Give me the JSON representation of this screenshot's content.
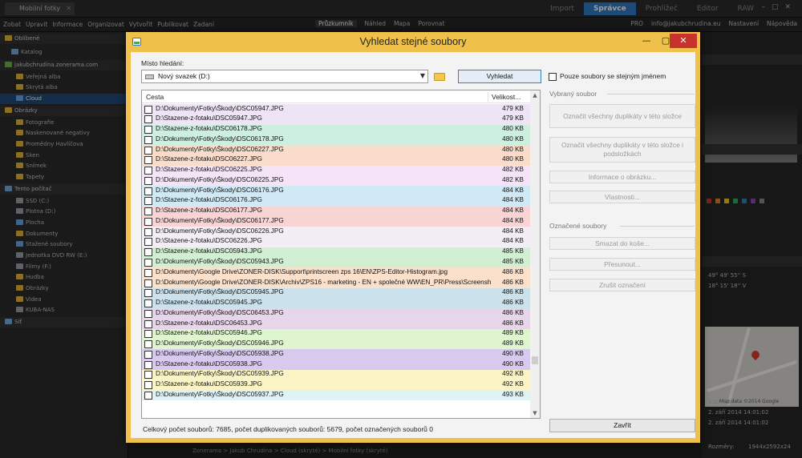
{
  "app": {
    "tab_title": "Mobilní fotky",
    "modes": [
      "Import",
      "Správce",
      "Prohlížeč",
      "Editor",
      "RAW"
    ],
    "active_mode": "Správce",
    "menu": [
      "Zobat",
      "Upravit",
      "Informace",
      "Organizovat",
      "Vytvořit",
      "Publikovat",
      "Zadaní"
    ],
    "views": [
      "Průzkumník",
      "Náhled",
      "Mapa",
      "Porovnat"
    ],
    "user_badge": "PRO",
    "user_email": "info@jakubchrudina.eu",
    "settings_label": "Nastavení",
    "help_label": "Nápověda",
    "sidebar": [
      {
        "label": "Oblíbené",
        "type": "hdr",
        "color": "#e3b23c"
      },
      {
        "label": "Katalog",
        "type": "item",
        "color": "#7aa7d8"
      },
      {
        "label": "jakubchrudina.zonerama.com",
        "type": "hdr",
        "color": "#6fb24a"
      },
      {
        "label": "Veřejná alba",
        "type": "item",
        "color": "#e3b23c"
      },
      {
        "label": "Skrytá alba",
        "type": "item",
        "color": "#e3b23c"
      },
      {
        "label": "Cloud",
        "type": "sel",
        "color": "#6aa5e0"
      },
      {
        "label": "Obrázky",
        "type": "hdr",
        "color": "#e3b23c"
      },
      {
        "label": "Fotografie",
        "type": "item",
        "color": "#e3b23c"
      },
      {
        "label": "Naskenované negativy",
        "type": "item",
        "color": "#e3b23c"
      },
      {
        "label": "Promědny Havlíčova",
        "type": "item",
        "color": "#e3b23c"
      },
      {
        "label": "Sken",
        "type": "item",
        "color": "#e3b23c"
      },
      {
        "label": "Snímek",
        "type": "item",
        "color": "#e3b23c"
      },
      {
        "label": "Tapety",
        "type": "item",
        "color": "#e3b23c"
      },
      {
        "label": "Tento počítač",
        "type": "hdr",
        "color": "#7aa7d8"
      },
      {
        "label": "SSD (C:)",
        "type": "item",
        "color": "#9aa0a6"
      },
      {
        "label": "Plotna (D:)",
        "type": "item",
        "color": "#9aa0a6"
      },
      {
        "label": "Plocha",
        "type": "item",
        "color": "#6aa5e0"
      },
      {
        "label": "Dokumenty",
        "type": "item",
        "color": "#e3b23c"
      },
      {
        "label": "Stažené soubory",
        "type": "item",
        "color": "#6aa5e0"
      },
      {
        "label": "Jednotka DVD RW (E:)",
        "type": "item",
        "color": "#9aa0a6"
      },
      {
        "label": "Filmy (F:)",
        "type": "item",
        "color": "#9aa0a6"
      },
      {
        "label": "Hudba",
        "type": "item",
        "color": "#e3b23c"
      },
      {
        "label": "Obrázky",
        "type": "item",
        "color": "#e3b23c"
      },
      {
        "label": "Videa",
        "type": "item",
        "color": "#e3b23c"
      },
      {
        "label": "KUBA-NAS",
        "type": "item",
        "color": "#9aa0a6"
      },
      {
        "label": "Síť",
        "type": "hdr",
        "color": "#7aa7d8"
      }
    ],
    "info_panel": {
      "gps_lat": "49° 49' 55'' S",
      "gps_lon": "18° 15' 18'' V",
      "map_credit": "Map data ©2014 Google",
      "file_size": "1,07 MB",
      "date_created": "2. září 2014 14:01:02",
      "date_modified": "2. září 2014 14:01:02",
      "dimensions_label": "Rozměry:",
      "dimensions": "1944x2592x24"
    },
    "breadcrumb": "Zonerama > Jakub Chrudina > Cloud (skryté) > Mobilní fotky (skryté)"
  },
  "dialog": {
    "title": "Vyhledat stejné soubory",
    "search_location_label": "Místo hledání:",
    "drive_value": "Nový svazek (D:)",
    "search_button": "Vyhledat",
    "same_name_label": "Pouze soubory se stejným jménem",
    "same_name_checked": false,
    "selected_file_group": "Vybraný soubor",
    "mark_dups_folder": "Označit všechny duplikáty v této složce",
    "mark_dups_subfolders": "Označit všechny duplikáty v této složce i podsložkách",
    "image_info": "Informace o obrázku...",
    "properties": "Vlastnosti...",
    "marked_files_group": "Označené soubory",
    "delete_to_trash": "Smazat do koše...",
    "move": "Přesunout...",
    "unmark": "Zrušit označení",
    "close": "Zavřít",
    "col_path": "Cesta",
    "col_size": "Velikost...",
    "status": "Celkový počet souborů: 7685, počet duplikovaných souborů: 5679, počet označených souborů 0",
    "rows": [
      {
        "path": "D:\\Dokumenty\\Fotky\\Škody\\DSC05947.JPG",
        "size": "479 KB",
        "color": "#efe3f6"
      },
      {
        "path": "D:\\Stazene-z-fotaku\\DSC05947.JPG",
        "size": "479 KB",
        "color": "#efe3f6"
      },
      {
        "path": "D:\\Stazene-z-fotaku\\DSC06178.JPG",
        "size": "480 KB",
        "color": "#ccefe0"
      },
      {
        "path": "D:\\Dokumenty\\Fotky\\Škody\\DSC06178.JPG",
        "size": "480 KB",
        "color": "#ccefe0"
      },
      {
        "path": "D:\\Dokumenty\\Fotky\\Škody\\DSC06227.JPG",
        "size": "480 KB",
        "color": "#f9dcc9"
      },
      {
        "path": "D:\\Stazene-z-fotaku\\DSC06227.JPG",
        "size": "480 KB",
        "color": "#f9dcc9"
      },
      {
        "path": "D:\\Stazene-z-fotaku\\DSC06225.JPG",
        "size": "482 KB",
        "color": "#f5e3f7"
      },
      {
        "path": "D:\\Dokumenty\\Fotky\\Škody\\DSC06225.JPG",
        "size": "482 KB",
        "color": "#f5e3f7"
      },
      {
        "path": "D:\\Dokumenty\\Fotky\\Škody\\DSC06176.JPG",
        "size": "484 KB",
        "color": "#cfe9f5"
      },
      {
        "path": "D:\\Stazene-z-fotaku\\DSC06176.JPG",
        "size": "484 KB",
        "color": "#cfe9f5"
      },
      {
        "path": "D:\\Stazene-z-fotaku\\DSC06177.JPG",
        "size": "484 KB",
        "color": "#f8d4d4"
      },
      {
        "path": "D:\\Dokumenty\\Fotky\\Škody\\DSC06177.JPG",
        "size": "484 KB",
        "color": "#f8d4d4"
      },
      {
        "path": "D:\\Dokumenty\\Fotky\\Škody\\DSC06226.JPG",
        "size": "484 KB",
        "color": "#f3eef6"
      },
      {
        "path": "D:\\Stazene-z-fotaku\\DSC06226.JPG",
        "size": "484 KB",
        "color": "#f3eef6"
      },
      {
        "path": "D:\\Stazene-z-fotaku\\DSC05943.JPG",
        "size": "485 KB",
        "color": "#d3efd3"
      },
      {
        "path": "D:\\Dokumenty\\Fotky\\Škody\\DSC05943.JPG",
        "size": "485 KB",
        "color": "#d3efd3"
      },
      {
        "path": "D:\\Dokumenty\\Google Drive\\ZONER-DISK\\Support\\printscreen zps 16\\EN\\ZPS-Editor-Histogram.jpg",
        "size": "486 KB",
        "color": "#fbe1cc"
      },
      {
        "path": "D:\\Dokumenty\\Google Drive\\ZONER-DISK\\Archiv\\ZPS16 - marketing - EN + společné WW\\EN_PR\\Press\\Screenshots\\ZPS-Editor-Histogram.jpg",
        "size": "486 KB",
        "color": "#fbe1cc"
      },
      {
        "path": "D:\\Dokumenty\\Fotky\\Škody\\DSC05945.JPG",
        "size": "486 KB",
        "color": "#cbe2ec"
      },
      {
        "path": "D:\\Stazene-z-fotaku\\DSC05945.JPG",
        "size": "486 KB",
        "color": "#cbe2ec"
      },
      {
        "path": "D:\\Dokumenty\\Fotky\\Škody\\DSC06453.JPG",
        "size": "486 KB",
        "color": "#e7d5ea"
      },
      {
        "path": "D:\\Stazene-z-fotaku\\DSC06453.JPG",
        "size": "486 KB",
        "color": "#e7d5ea"
      },
      {
        "path": "D:\\Stazene-z-fotaku\\DSC05946.JPG",
        "size": "489 KB",
        "color": "#dff5cf"
      },
      {
        "path": "D:\\Dokumenty\\Fotky\\Škody\\DSC05946.JPG",
        "size": "489 KB",
        "color": "#dff5cf"
      },
      {
        "path": "D:\\Dokumenty\\Fotky\\Škody\\DSC05938.JPG",
        "size": "490 KB",
        "color": "#d8c9ef"
      },
      {
        "path": "D:\\Stazene-z-fotaku\\DSC05938.JPG",
        "size": "490 KB",
        "color": "#d8c9ef"
      },
      {
        "path": "D:\\Dokumenty\\Fotky\\Škody\\DSC05939.JPG",
        "size": "492 KB",
        "color": "#fbf5c6"
      },
      {
        "path": "D:\\Stazene-z-fotaku\\DSC05939.JPG",
        "size": "492 KB",
        "color": "#fbf5c6"
      },
      {
        "path": "D:\\Dokumenty\\Fotky\\Škody\\DSC05937.JPG",
        "size": "493 KB",
        "color": "#dff2f5"
      }
    ]
  }
}
